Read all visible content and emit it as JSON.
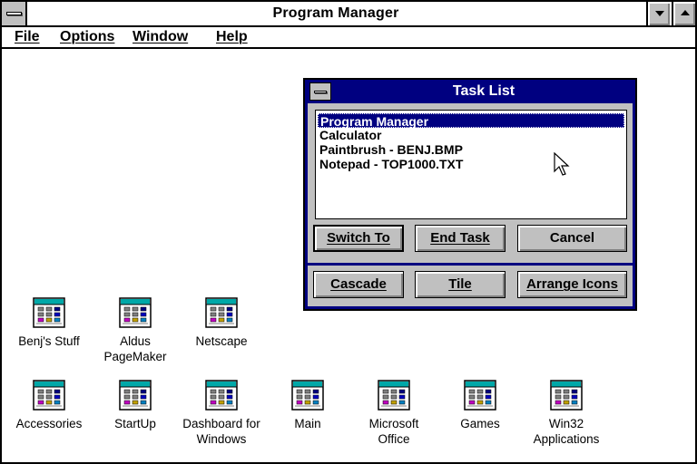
{
  "window": {
    "title": "Program Manager"
  },
  "menu": [
    {
      "label": "File"
    },
    {
      "label": "Options"
    },
    {
      "label": "Window"
    },
    {
      "label": "Help"
    }
  ],
  "group_icons": [
    {
      "label": "Benj's Stuff",
      "icon": "program-group-icon"
    },
    {
      "label": "Aldus PageMaker",
      "icon": "program-group-icon"
    },
    {
      "label": "Netscape",
      "icon": "program-group-icon"
    },
    {
      "label": "Accessories",
      "icon": "program-group-icon"
    },
    {
      "label": "StartUp",
      "icon": "program-group-icon"
    },
    {
      "label": "Dashboard for Windows",
      "icon": "program-group-icon"
    },
    {
      "label": "Main",
      "icon": "program-group-icon"
    },
    {
      "label": "Microsoft Office",
      "icon": "program-group-icon"
    },
    {
      "label": "Games",
      "icon": "program-group-icon"
    },
    {
      "label": "Win32 Applications",
      "icon": "program-group-icon"
    }
  ],
  "task_list": {
    "title": "Task List",
    "tasks": [
      {
        "label": "Program Manager",
        "selected": true
      },
      {
        "label": "Calculator",
        "selected": false
      },
      {
        "label": "Paintbrush - BENJ.BMP",
        "selected": false
      },
      {
        "label": "Notepad - TOP1000.TXT",
        "selected": false
      }
    ],
    "buttons": {
      "switch_to": "Switch To",
      "end_task": "End Task",
      "cancel": "Cancel",
      "cascade": "Cascade",
      "tile": "Tile",
      "arrange_icons": "Arrange Icons"
    }
  },
  "colors": {
    "titlebar_active": "#000080",
    "face": "#c0c0c0",
    "desktop": "#ffffff"
  }
}
